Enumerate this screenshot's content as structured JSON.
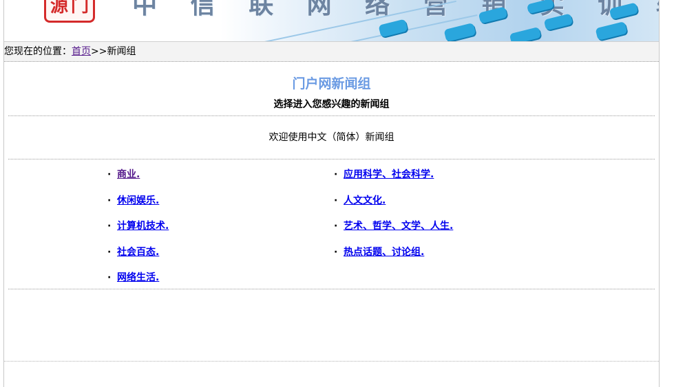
{
  "banner": {
    "logo_text": "源门",
    "title": "中 信 联 网 络 营 销 实 训 软 件",
    "colors": {
      "seal": "#d42a2a",
      "keys": "#2aa6dd",
      "title": "#6d84a1"
    }
  },
  "breadcrumb": {
    "prefix": "您现在的位置：",
    "home_link": "首页",
    "separator": ">>",
    "current": "新闻组"
  },
  "main": {
    "title": "门户网新闻组",
    "subtitle": "选择进入您感兴趣的新闻组",
    "welcome": "欢迎使用中文（简体）新闻组",
    "bullet": "·",
    "groups_left": [
      {
        "label": "商业."
      },
      {
        "label": "休闲娱乐."
      },
      {
        "label": "计算机技术."
      },
      {
        "label": "社会百态."
      },
      {
        "label": "网络生活."
      }
    ],
    "groups_right": [
      {
        "label": "应用科学、社会科学."
      },
      {
        "label": "人文文化."
      },
      {
        "label": "艺术、哲学、文学、人生."
      },
      {
        "label": "热点话题、讨论组."
      }
    ]
  }
}
